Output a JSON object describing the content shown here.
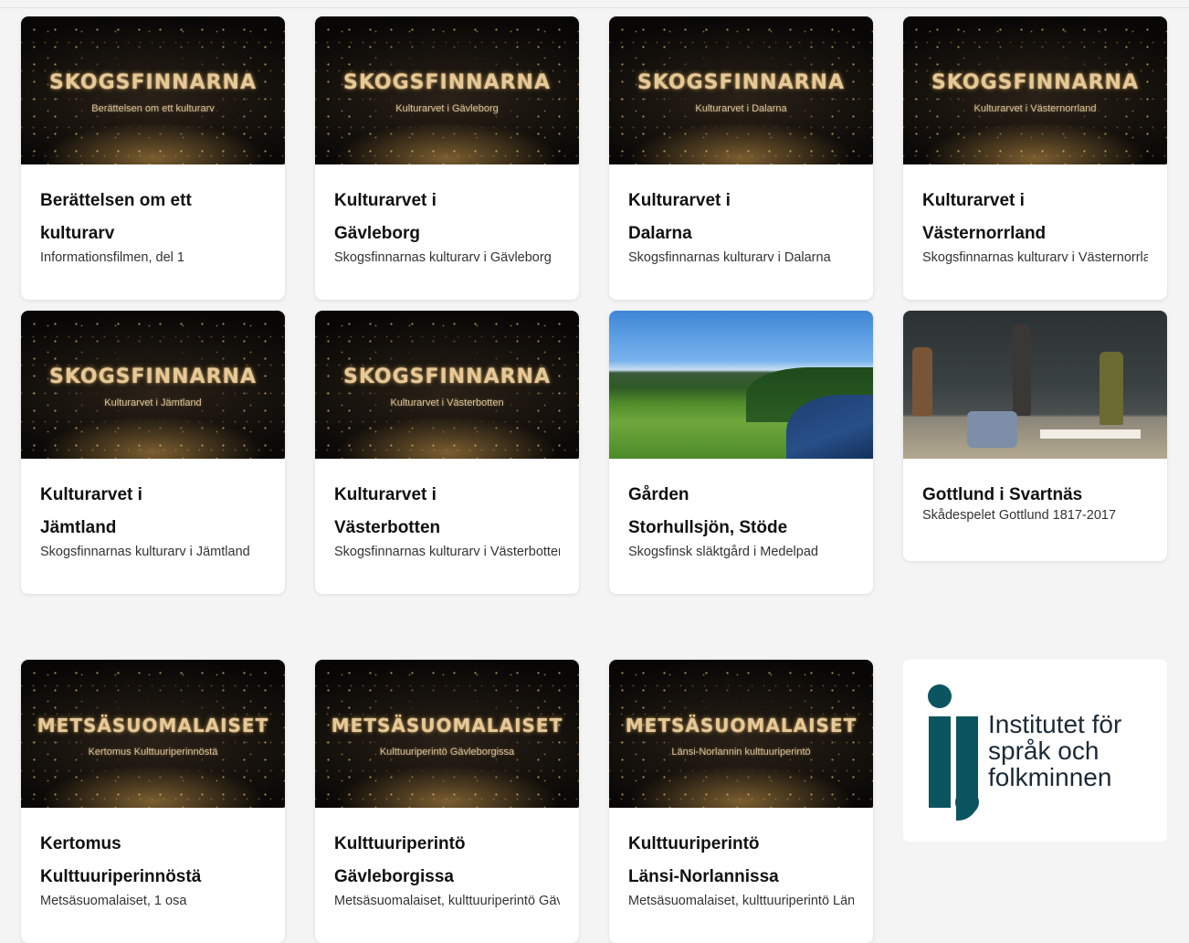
{
  "cards": [
    {
      "thumb_title": "SKOGSFINNARNA",
      "thumb_sub": "Berättelsen om ett kulturarv",
      "title1": "Berättelsen om ett",
      "title2": "kulturarv",
      "desc": "Informationsfilmen, del 1"
    },
    {
      "thumb_title": "SKOGSFINNARNA",
      "thumb_sub": "Kulturarvet i Gävleborg",
      "title1": "Kulturarvet i",
      "title2": "Gävleborg",
      "desc": "Skogsfinnarnas kulturarv i Gävleborg"
    },
    {
      "thumb_title": "SKOGSFINNARNA",
      "thumb_sub": "Kulturarvet i Dalarna",
      "title1": "Kulturarvet i",
      "title2": "Dalarna",
      "desc": "Skogsfinnarnas kulturarv i Dalarna"
    },
    {
      "thumb_title": "SKOGSFINNARNA",
      "thumb_sub": "Kulturarvet i Västernorrland",
      "title1": "Kulturarvet i",
      "title2": "Västernorrland",
      "desc": "Skogsfinnarnas kulturarv i Västernorrland"
    },
    {
      "thumb_title": "SKOGSFINNARNA",
      "thumb_sub": "Kulturarvet i Jämtland",
      "title1": "Kulturarvet i",
      "title2": "Jämtland",
      "desc": "Skogsfinnarnas kulturarv i Jämtland"
    },
    {
      "thumb_title": "SKOGSFINNARNA",
      "thumb_sub": "Kulturarvet i Västerbotten",
      "title1": "Kulturarvet i",
      "title2": "Västerbotten",
      "desc": "Skogsfinnarnas kulturarv i Västerbotten"
    },
    {
      "title1": "Gården",
      "title2": "Storhullsjön, Stöde",
      "desc": "Skogsfinsk släktgård i Medelpad"
    },
    {
      "title1": "Gottlund i Svartnäs",
      "desc": "Skådespelet Gottlund 1817-2017"
    },
    {
      "thumb_title": "METSÄSUOMALAISET",
      "thumb_sub": "Kertomus Kulttuuriperinnöstä",
      "title1": "Kertomus",
      "title2": "Kulttuuriperinnöstä",
      "desc": "Metsäsuomalaiset, 1 osa"
    },
    {
      "thumb_title": "METSÄSUOMALAISET",
      "thumb_sub": "Kulttuuriperintö Gävleborgissa",
      "title1": "Kulttuuriperintö",
      "title2": "Gävleborgissa",
      "desc": "Metsäsuomalaiset, kulttuuriperintö Gävleborgissa"
    },
    {
      "thumb_title": "METSÄSUOMALAISET",
      "thumb_sub": "Länsi-Norlannin kulttuuriperintö",
      "title1": "Kulttuuriperintö",
      "title2": "Länsi-Norlannissa",
      "desc": "Metsäsuomalaiset, kulttuuriperintö Länsi-Norlannissa"
    }
  ],
  "logo": {
    "line1": "Institutet för",
    "line2": "språk och",
    "line3": "folkminnen",
    "color": "#0b5560"
  }
}
